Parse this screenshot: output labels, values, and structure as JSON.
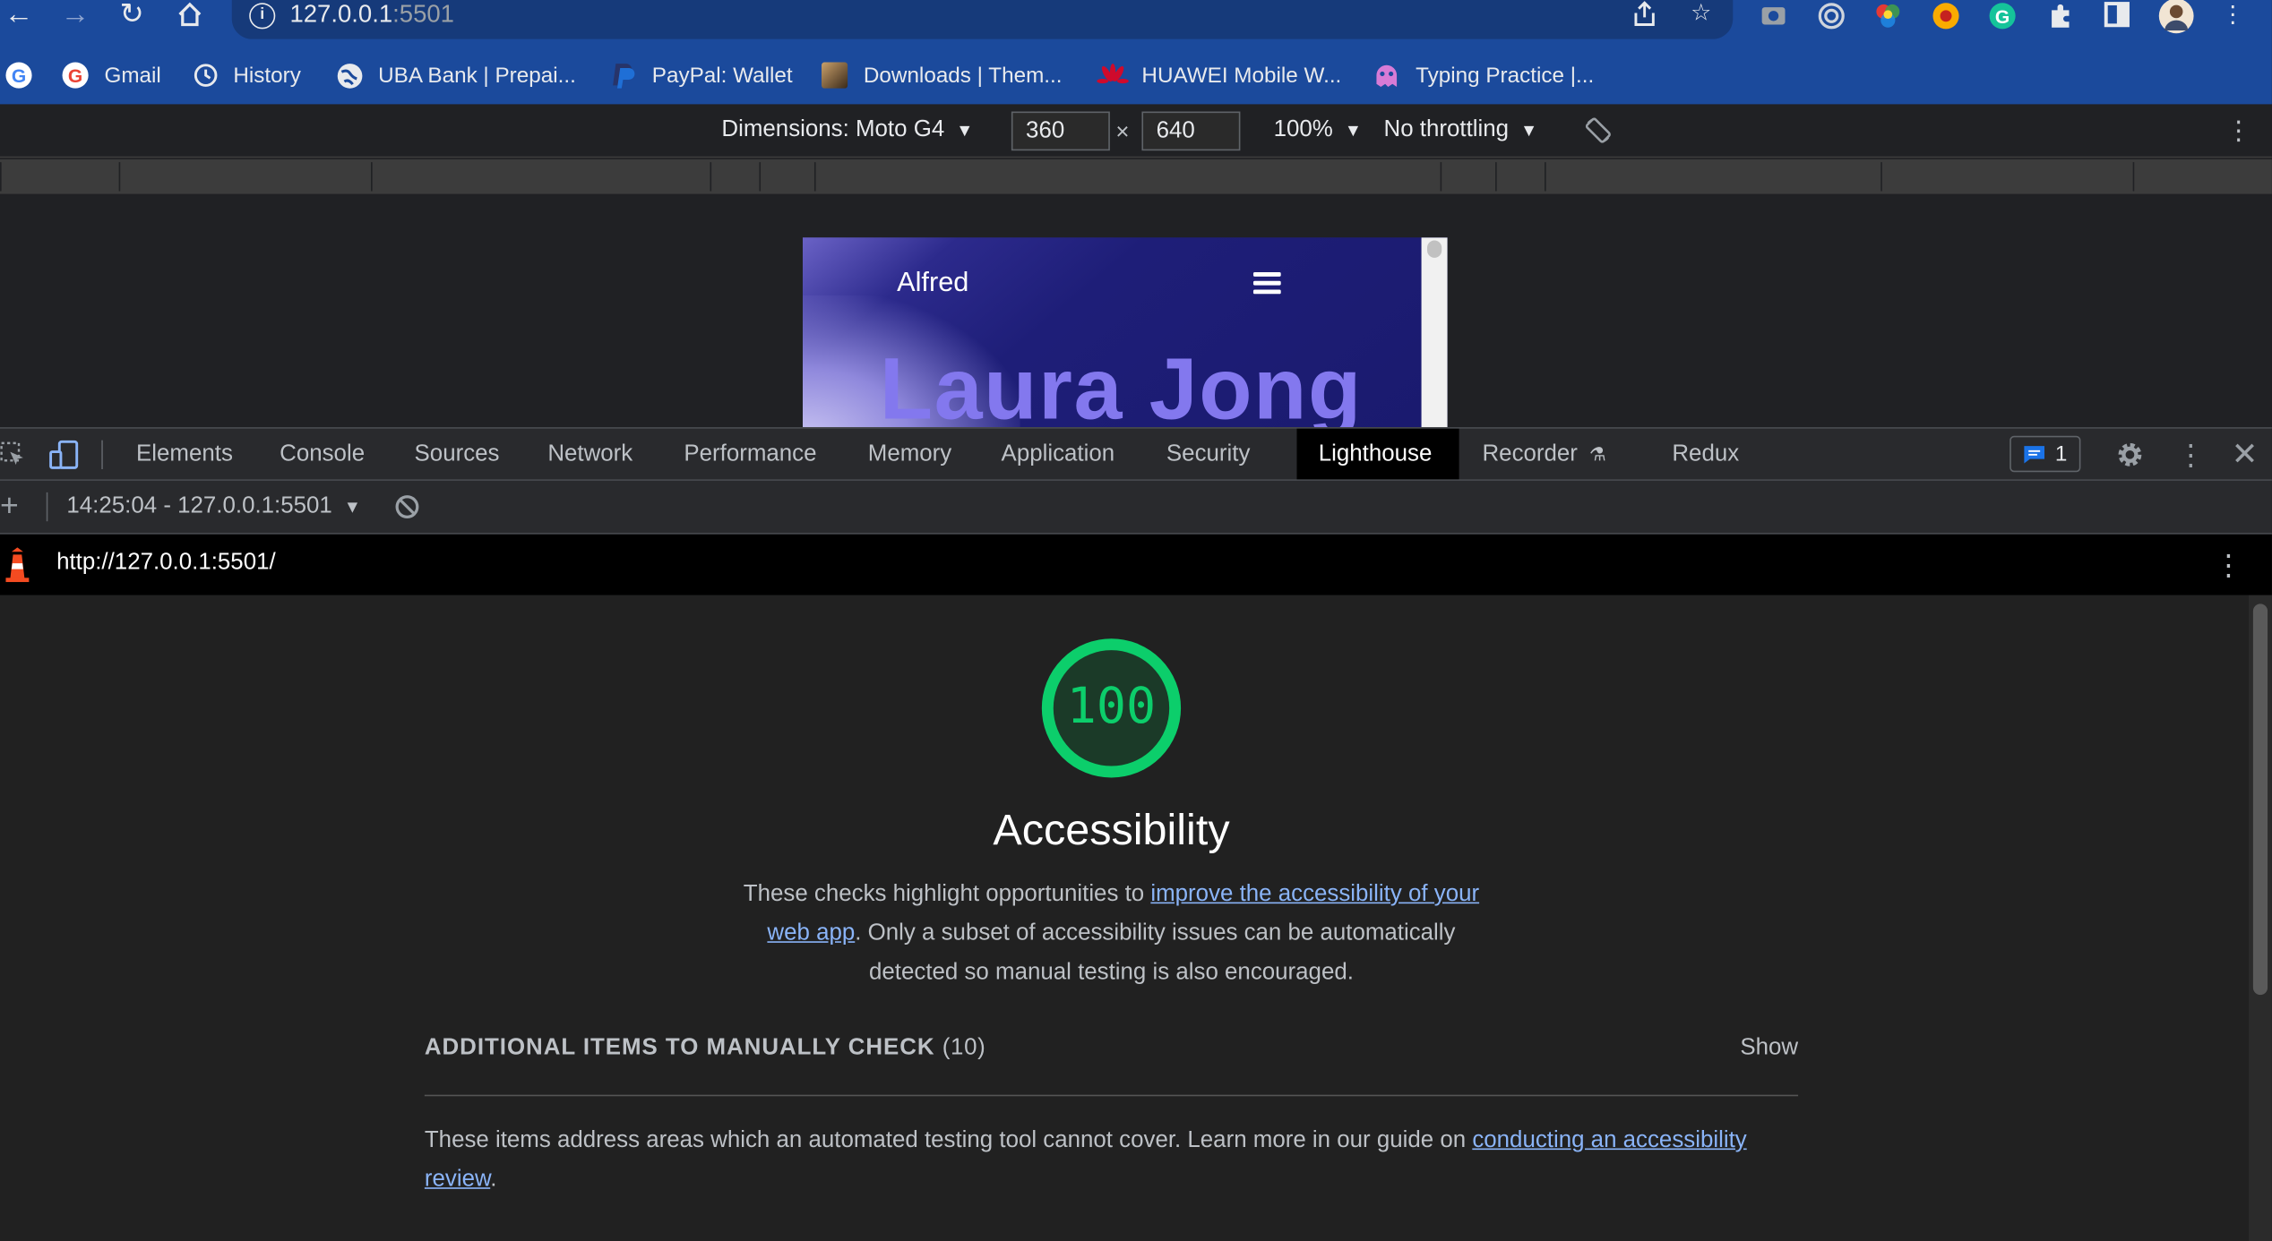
{
  "browser": {
    "url_host": "127.0.0.1",
    "url_port": ":5501",
    "bookmarks": [
      {
        "label": "Gmail",
        "color": "#ffffff",
        "icon": "google-icon"
      },
      {
        "label": "History",
        "color": "#e8eaed",
        "icon": "history-icon"
      },
      {
        "label": "UBA Bank | Prepai...",
        "color": "#ffffff",
        "icon": "globe-icon"
      },
      {
        "label": "PayPal: Wallet",
        "color": "#1f6fd6",
        "icon": "paypal-icon"
      },
      {
        "label": "Downloads | Them...",
        "color": "#5a4632",
        "icon": "downloads-favicon"
      },
      {
        "label": "HUAWEI Mobile W...",
        "color": "#cf0a2c",
        "icon": "huawei-icon"
      },
      {
        "label": "Typing Practice |...",
        "color": "#d77bd6",
        "icon": "typing-icon"
      }
    ]
  },
  "device_toolbar": {
    "dimensions_label": "Dimensions: Moto G4",
    "width": "360",
    "times": "×",
    "height": "640",
    "zoom": "100%",
    "throttling": "No throttling"
  },
  "preview": {
    "brand": "Alfred",
    "hero": "Laura Jong"
  },
  "devtools": {
    "tabs": [
      "Elements",
      "Console",
      "Sources",
      "Network",
      "Performance",
      "Memory",
      "Application",
      "Security",
      "Lighthouse",
      "Recorder",
      "Redux"
    ],
    "active_tab": "Lighthouse",
    "issues_count": "1",
    "report_selector": "14:25:04 - 127.0.0.1:5501",
    "report_url": "http://127.0.0.1:5501/"
  },
  "lighthouse": {
    "score": "100",
    "score_fraction": 1.0,
    "score_color": "#0cce6b",
    "category_title": "Accessibility",
    "desc_prefix": "These checks highlight opportunities to ",
    "desc_link": "improve the accessibility of your web app",
    "desc_suffix": ". Only a subset of accessibility issues can be automatically detected so manual testing is also encouraged.",
    "manual_title": "ADDITIONAL ITEMS TO MANUALLY CHECK",
    "manual_count": "(10)",
    "manual_toggle": "Show",
    "manual_desc_prefix": "These items address areas which an automated testing tool cannot cover. Learn more in our guide on ",
    "manual_desc_link": "conducting an accessibility review",
    "manual_desc_suffix": "."
  }
}
